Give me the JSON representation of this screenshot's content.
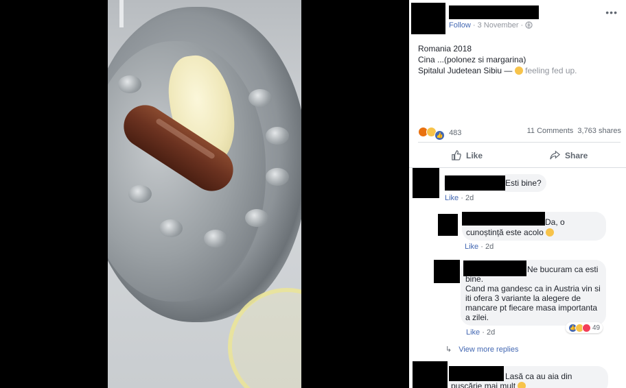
{
  "post": {
    "follow_label": "Follow",
    "date": "· 3 November ·",
    "line1": "Romania 2018",
    "line2": "Cina ...(polonez si margarina)",
    "place": "Spitalul Judetean Sibiu",
    "dash": " — ",
    "feeling": "feeling fed up.",
    "reactions_count": "483",
    "comments_count": "11 Comments",
    "shares_count": "3,763 shares",
    "like_label": "Like",
    "share_label": "Share"
  },
  "comments": [
    {
      "text": "Esti bine?",
      "like": "Like",
      "age": "· 2d"
    },
    {
      "text_a": "Da, o",
      "text_b": "cunoștință este acolo",
      "like": "Like",
      "age": "· 2d"
    },
    {
      "text_a": "Ne bucuram ca esti",
      "text_b": "bine.",
      "text_c": "Cand ma gandesc ca in Austria vin si",
      "text_d": "iti ofera 3 variante la alegere de",
      "text_e": "mancare pt fiecare masa importanta",
      "text_f": "a zilei.",
      "reactions_count": "49",
      "like": "Like",
      "age": "· 2d"
    },
    {
      "text_a": "Lasă ca au aia din",
      "text_b": "pușcărie mai mult"
    }
  ],
  "view_more": "View more replies",
  "colors": {
    "link": "#4267b2",
    "muted": "#606770",
    "bubble": "#f2f3f5"
  },
  "icons": [
    "globe-icon",
    "more-options-icon",
    "thumbs-up-icon",
    "share-icon",
    "reply-arrow-icon",
    "emoji-icon"
  ]
}
